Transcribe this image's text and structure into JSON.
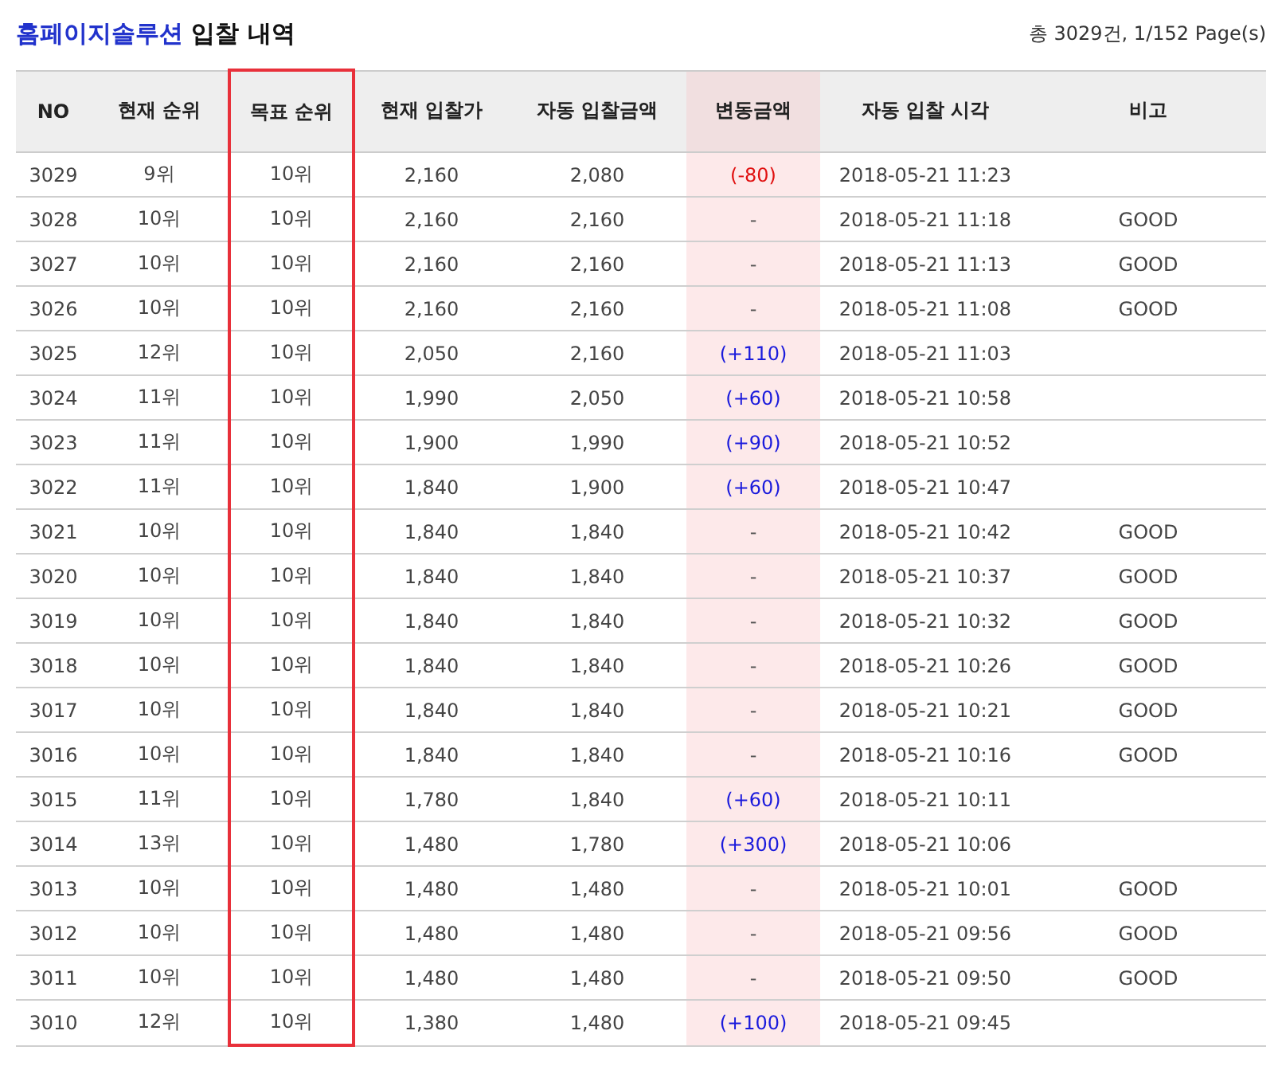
{
  "title": {
    "brand": "홈페이지솔루션",
    "text": "입찰 내역"
  },
  "summary": "총 3029건, 1/152 Page(s)",
  "table": {
    "columns": [
      {
        "label": "NO",
        "highlighted": false,
        "outlined": false
      },
      {
        "label": "현재 순위",
        "highlighted": false,
        "outlined": false
      },
      {
        "label": "목표 순위",
        "highlighted": false,
        "outlined": true
      },
      {
        "label": "현재 입찰가",
        "highlighted": false,
        "outlined": false
      },
      {
        "label": "자동 입찰금액",
        "highlighted": false,
        "outlined": false
      },
      {
        "label": "변동금액",
        "highlighted": true,
        "outlined": false
      },
      {
        "label": "자동 입찰 시각",
        "highlighted": false,
        "outlined": false
      },
      {
        "label": "비고",
        "highlighted": false,
        "outlined": false
      }
    ],
    "rows": [
      {
        "no": "3029",
        "rank": "9위",
        "target": "10위",
        "bid": "2,160",
        "auto_bid": "2,080",
        "change": {
          "kind": "decrease",
          "text": "(-80)"
        },
        "time": "2018-05-21 11:23"
      },
      {
        "no": "3028",
        "rank": "10위",
        "target": "10위",
        "bid": "2,160",
        "auto_bid": "2,160",
        "change": {
          "kind": "none",
          "text": "-"
        },
        "time": "2018-05-21 11:18",
        "note": "GOOD"
      },
      {
        "no": "3027",
        "rank": "10위",
        "target": "10위",
        "bid": "2,160",
        "auto_bid": "2,160",
        "change": {
          "kind": "none",
          "text": "-"
        },
        "time": "2018-05-21 11:13",
        "note": "GOOD"
      },
      {
        "no": "3026",
        "rank": "10위",
        "target": "10위",
        "bid": "2,160",
        "auto_bid": "2,160",
        "change": {
          "kind": "none",
          "text": "-"
        },
        "time": "2018-05-21 11:08",
        "note": "GOOD"
      },
      {
        "no": "3025",
        "rank": "12위",
        "target": "10위",
        "bid": "2,050",
        "auto_bid": "2,160",
        "change": {
          "kind": "increase",
          "text": "(+110)"
        },
        "time": "2018-05-21 11:03"
      },
      {
        "no": "3024",
        "rank": "11위",
        "target": "10위",
        "bid": "1,990",
        "auto_bid": "2,050",
        "change": {
          "kind": "increase",
          "text": "(+60)"
        },
        "time": "2018-05-21 10:58"
      },
      {
        "no": "3023",
        "rank": "11위",
        "target": "10위",
        "bid": "1,900",
        "auto_bid": "1,990",
        "change": {
          "kind": "increase",
          "text": "(+90)"
        },
        "time": "2018-05-21 10:52"
      },
      {
        "no": "3022",
        "rank": "11위",
        "target": "10위",
        "bid": "1,840",
        "auto_bid": "1,900",
        "change": {
          "kind": "increase",
          "text": "(+60)"
        },
        "time": "2018-05-21 10:47"
      },
      {
        "no": "3021",
        "rank": "10위",
        "target": "10위",
        "bid": "1,840",
        "auto_bid": "1,840",
        "change": {
          "kind": "none",
          "text": "-"
        },
        "time": "2018-05-21 10:42",
        "note": "GOOD"
      },
      {
        "no": "3020",
        "rank": "10위",
        "target": "10위",
        "bid": "1,840",
        "auto_bid": "1,840",
        "change": {
          "kind": "none",
          "text": "-"
        },
        "time": "2018-05-21 10:37",
        "note": "GOOD"
      },
      {
        "no": "3019",
        "rank": "10위",
        "target": "10위",
        "bid": "1,840",
        "auto_bid": "1,840",
        "change": {
          "kind": "none",
          "text": "-"
        },
        "time": "2018-05-21 10:32",
        "note": "GOOD"
      },
      {
        "no": "3018",
        "rank": "10위",
        "target": "10위",
        "bid": "1,840",
        "auto_bid": "1,840",
        "change": {
          "kind": "none",
          "text": "-"
        },
        "time": "2018-05-21 10:26",
        "note": "GOOD"
      },
      {
        "no": "3017",
        "rank": "10위",
        "target": "10위",
        "bid": "1,840",
        "auto_bid": "1,840",
        "change": {
          "kind": "none",
          "text": "-"
        },
        "time": "2018-05-21 10:21",
        "note": "GOOD"
      },
      {
        "no": "3016",
        "rank": "10위",
        "target": "10위",
        "bid": "1,840",
        "auto_bid": "1,840",
        "change": {
          "kind": "none",
          "text": "-"
        },
        "time": "2018-05-21 10:16",
        "note": "GOOD"
      },
      {
        "no": "3015",
        "rank": "11위",
        "target": "10위",
        "bid": "1,780",
        "auto_bid": "1,840",
        "change": {
          "kind": "increase",
          "text": "(+60)"
        },
        "time": "2018-05-21 10:11"
      },
      {
        "no": "3014",
        "rank": "13위",
        "target": "10위",
        "bid": "1,480",
        "auto_bid": "1,780",
        "change": {
          "kind": "increase",
          "text": "(+300)"
        },
        "time": "2018-05-21 10:06"
      },
      {
        "no": "3013",
        "rank": "10위",
        "target": "10위",
        "bid": "1,480",
        "auto_bid": "1,480",
        "change": {
          "kind": "none",
          "text": "-"
        },
        "time": "2018-05-21 10:01",
        "note": "GOOD"
      },
      {
        "no": "3012",
        "rank": "10위",
        "target": "10위",
        "bid": "1,480",
        "auto_bid": "1,480",
        "change": {
          "kind": "none",
          "text": "-"
        },
        "time": "2018-05-21 09:56",
        "note": "GOOD"
      },
      {
        "no": "3011",
        "rank": "10위",
        "target": "10위",
        "bid": "1,480",
        "auto_bid": "1,480",
        "change": {
          "kind": "none",
          "text": "-"
        },
        "time": "2018-05-21 09:50",
        "note": "GOOD"
      },
      {
        "no": "3010",
        "rank": "12위",
        "target": "10위",
        "bid": "1,380",
        "auto_bid": "1,480",
        "change": {
          "kind": "increase",
          "text": "(+100)"
        },
        "time": "2018-05-21 09:45"
      }
    ]
  }
}
